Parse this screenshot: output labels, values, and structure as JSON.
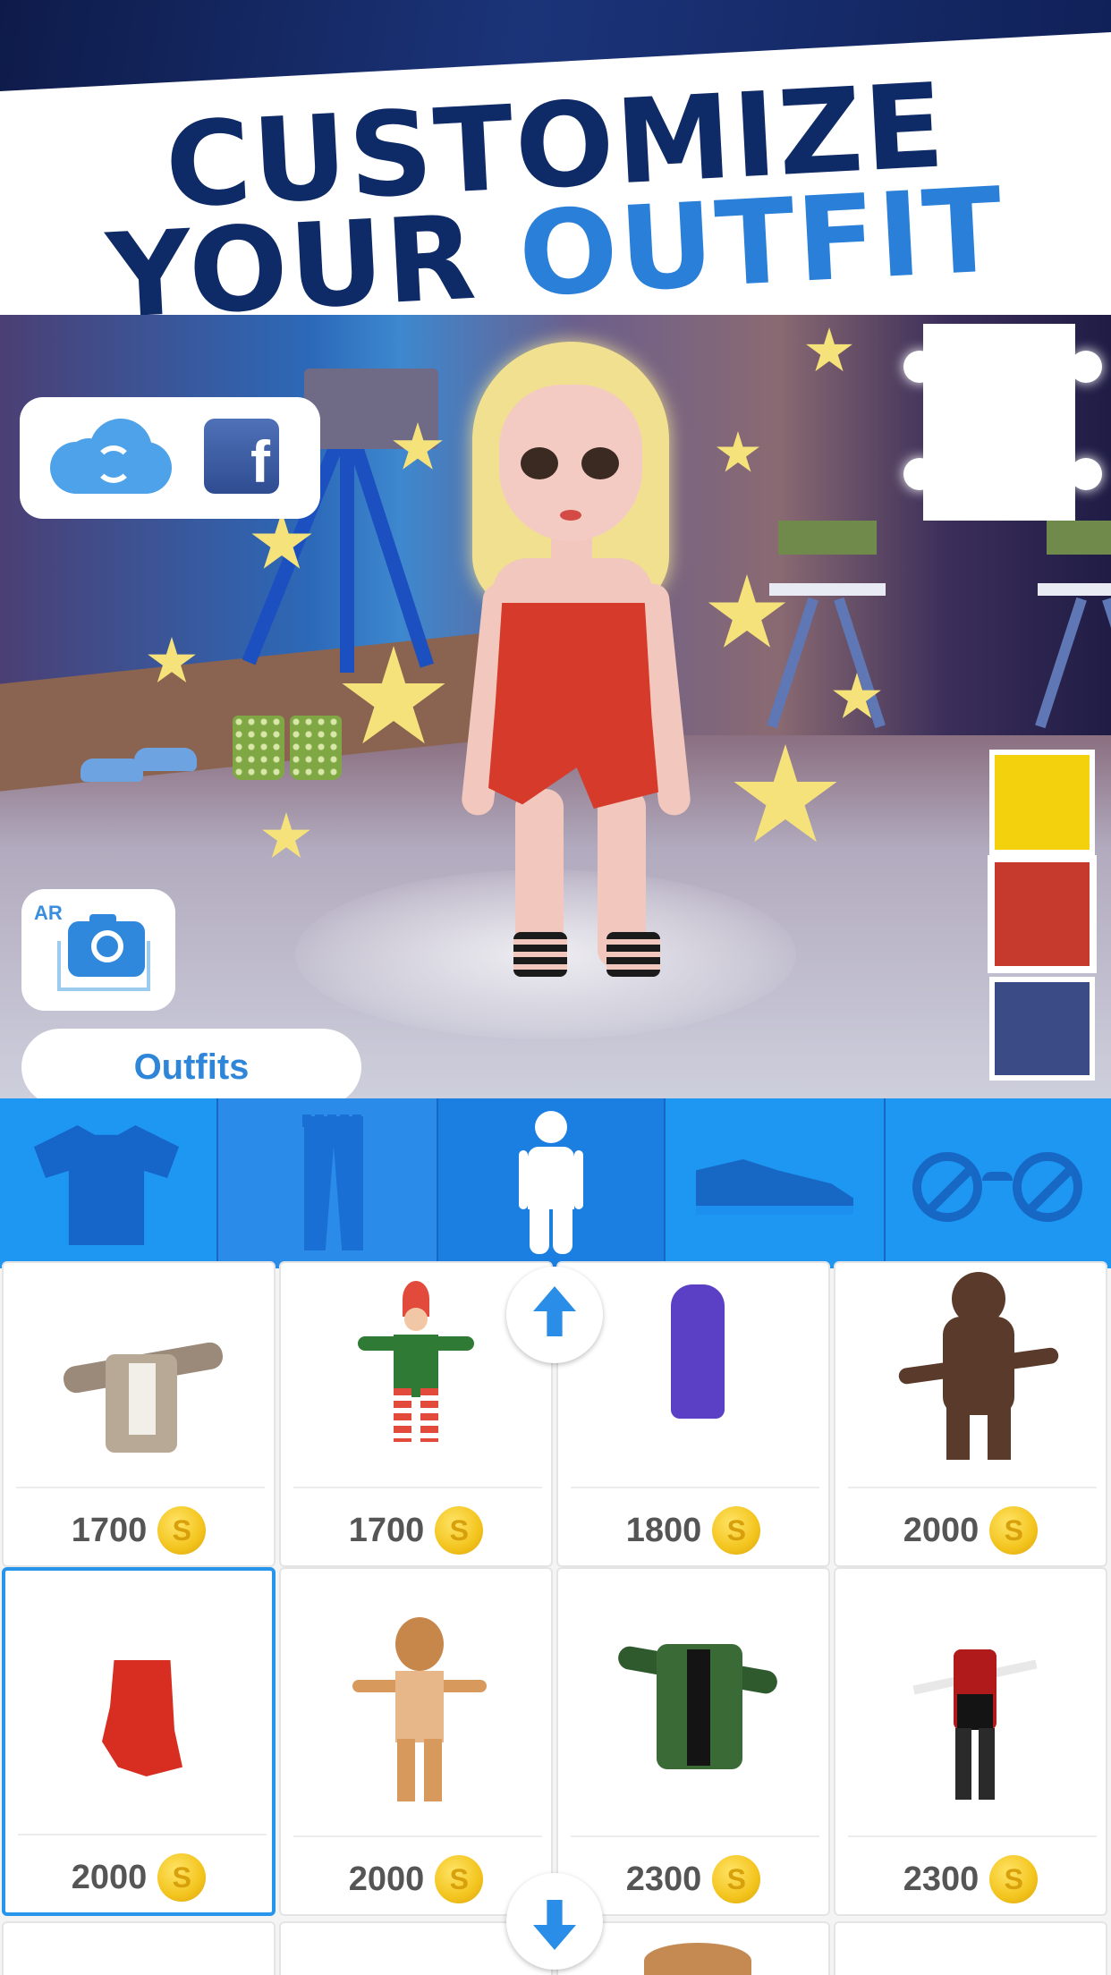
{
  "header": {
    "line1": "CUSTOMIZE",
    "line2_a": "YOUR",
    "line2_b": "OUTFIT"
  },
  "scene": {
    "share": {
      "cloud_icon": "cloud-sync-icon",
      "facebook_icon": "facebook-icon",
      "facebook_glyph": "f"
    },
    "ar_button": {
      "label": "AR",
      "icon": "camera-icon"
    },
    "outfits_button": "Outfits",
    "color_swatches": [
      "#f3d10d",
      "#c53a2c",
      "#3b4b86"
    ],
    "selected_swatch": 1
  },
  "tabs": [
    {
      "name": "tops",
      "icon": "tshirt-icon"
    },
    {
      "name": "bottoms",
      "icon": "pants-icon"
    },
    {
      "name": "outfits",
      "icon": "person-icon",
      "selected": true
    },
    {
      "name": "shoes",
      "icon": "sneaker-icon"
    },
    {
      "name": "accessories",
      "icon": "glasses-icon"
    }
  ],
  "items": [
    {
      "price": "1700",
      "coin": "S",
      "icon": "cardigan-item"
    },
    {
      "price": "1700",
      "coin": "S",
      "icon": "elf-costume-item"
    },
    {
      "price": "1800",
      "coin": "S",
      "icon": "purple-dress-item"
    },
    {
      "price": "2000",
      "coin": "S",
      "icon": "reindeer-costume-item"
    },
    {
      "price": "2000",
      "coin": "S",
      "icon": "red-dress-item",
      "selected": true
    },
    {
      "price": "2000",
      "coin": "S",
      "icon": "gingerbread-costume-item"
    },
    {
      "price": "2300",
      "coin": "S",
      "icon": "green-coat-item"
    },
    {
      "price": "2300",
      "coin": "S",
      "icon": "red-black-outfit-item"
    }
  ],
  "colors": {
    "brand_blue": "#1d8fee",
    "selected_border": "#2795ec",
    "coin_gold": "#f3c41d"
  }
}
